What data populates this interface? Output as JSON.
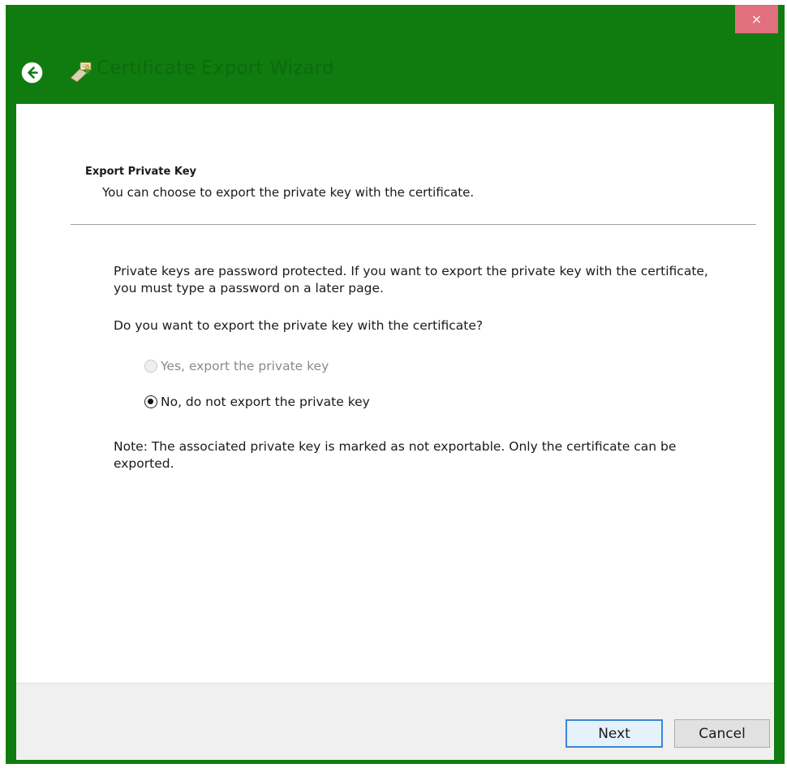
{
  "window": {
    "title": "Certificate Export Wizard",
    "close_glyph": "×",
    "accent_color": "#107c10",
    "close_color": "#e0707b"
  },
  "icons": {
    "back": "back-arrow-icon",
    "wizard": "certificate-icon"
  },
  "page": {
    "heading": "Export Private Key",
    "subheading": "You can choose to export the private key with the certificate.",
    "description": "Private keys are password protected. If you want to export the private key with the certificate, you must type a password on a later page.",
    "question": "Do you want to export the private key with the certificate?",
    "options": [
      {
        "label": "Yes, export the private key",
        "selected": false,
        "enabled": false
      },
      {
        "label": "No, do not export the private key",
        "selected": true,
        "enabled": true
      }
    ],
    "note": "Note: The associated private key is marked as not exportable. Only the certificate can be exported."
  },
  "footer": {
    "next_label": "Next",
    "cancel_label": "Cancel"
  }
}
